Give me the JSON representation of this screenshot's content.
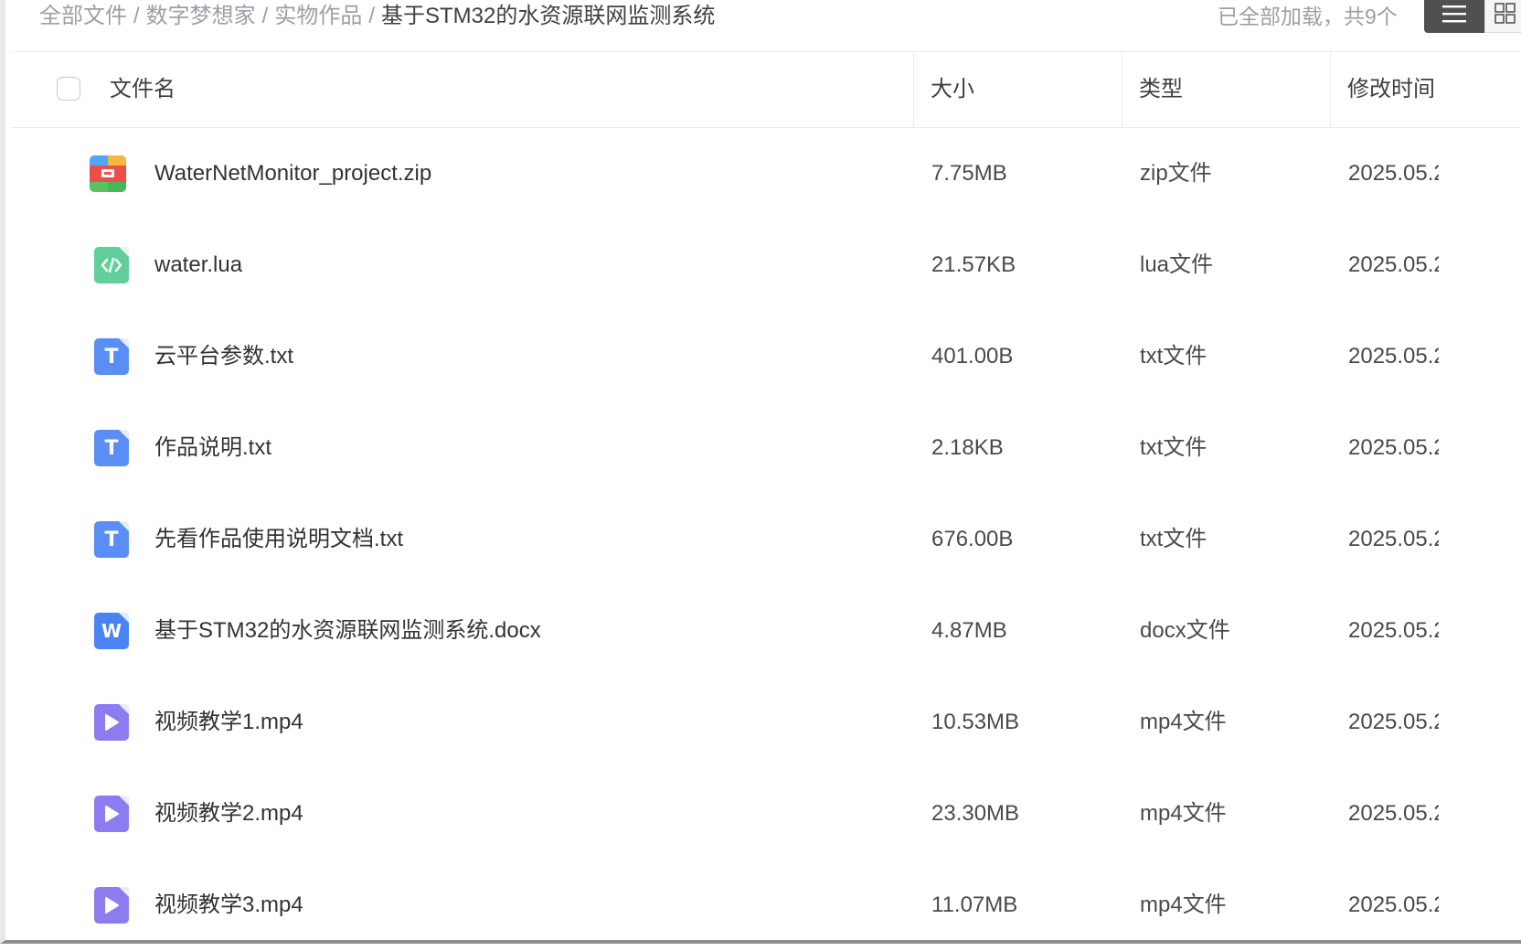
{
  "breadcrumb": {
    "items": [
      "全部文件",
      "数字梦想家",
      "实物作品"
    ],
    "separator": "/",
    "current": "基于STM32的水资源联网监测系统"
  },
  "status": {
    "loaded_text": "已全部加载，共9个"
  },
  "view_toggle": {
    "active": "list"
  },
  "table": {
    "headers": {
      "name": "文件名",
      "size": "大小",
      "type": "类型",
      "modified": "修改时间"
    },
    "rows": [
      {
        "icon": "zip-archive-icon",
        "icon_color": "#f0514a",
        "name": "WaterNetMonitor_project.zip",
        "size": "7.75MB",
        "type": "zip文件",
        "modified": "2025.05.2"
      },
      {
        "icon": "code-file-icon",
        "icon_color": "#62cf9b",
        "name": "water.lua",
        "size": "21.57KB",
        "type": "lua文件",
        "modified": "2025.05.2"
      },
      {
        "icon": "text-file-icon",
        "icon_color": "#5b8ef5",
        "name": "云平台参数.txt",
        "size": "401.00B",
        "type": "txt文件",
        "modified": "2025.05.2"
      },
      {
        "icon": "text-file-icon",
        "icon_color": "#5b8ef5",
        "name": "作品说明.txt",
        "size": "2.18KB",
        "type": "txt文件",
        "modified": "2025.05.2"
      },
      {
        "icon": "text-file-icon",
        "icon_color": "#5b8ef5",
        "name": "先看作品使用说明文档.txt",
        "size": "676.00B",
        "type": "txt文件",
        "modified": "2025.05.2"
      },
      {
        "icon": "word-doc-icon",
        "icon_color": "#4a83f3",
        "name": "基于STM32的水资源联网监测系统.docx",
        "size": "4.87MB",
        "type": "docx文件",
        "modified": "2025.05.2"
      },
      {
        "icon": "video-file-icon",
        "icon_color": "#8b7cf0",
        "name": "视频教学1.mp4",
        "size": "10.53MB",
        "type": "mp4文件",
        "modified": "2025.05.2"
      },
      {
        "icon": "video-file-icon",
        "icon_color": "#8b7cf0",
        "name": "视频教学2.mp4",
        "size": "23.30MB",
        "type": "mp4文件",
        "modified": "2025.05.2"
      },
      {
        "icon": "video-file-icon",
        "icon_color": "#8b7cf0",
        "name": "视频教学3.mp4",
        "size": "11.07MB",
        "type": "mp4文件",
        "modified": "2025.05.2"
      }
    ]
  }
}
